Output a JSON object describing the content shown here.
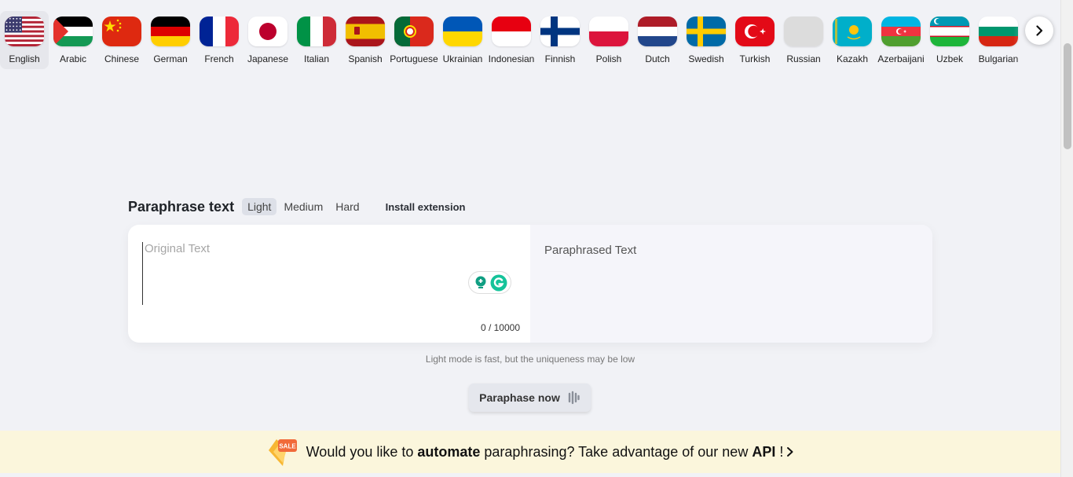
{
  "languages": [
    {
      "label": "English",
      "icon": "flag-us-icon",
      "selected": true
    },
    {
      "label": "Arabic",
      "icon": "flag-arabic-icon"
    },
    {
      "label": "Chinese",
      "icon": "flag-china-icon"
    },
    {
      "label": "German",
      "icon": "flag-germany-icon"
    },
    {
      "label": "French",
      "icon": "flag-france-icon"
    },
    {
      "label": "Japanese",
      "icon": "flag-japan-icon"
    },
    {
      "label": "Italian",
      "icon": "flag-italy-icon"
    },
    {
      "label": "Spanish",
      "icon": "flag-spain-icon"
    },
    {
      "label": "Portuguese",
      "icon": "flag-portugal-icon"
    },
    {
      "label": "Ukrainian",
      "icon": "flag-ukraine-icon"
    },
    {
      "label": "Indonesian",
      "icon": "flag-indonesia-icon"
    },
    {
      "label": "Finnish",
      "icon": "flag-finland-icon"
    },
    {
      "label": "Polish",
      "icon": "flag-poland-icon"
    },
    {
      "label": "Dutch",
      "icon": "flag-netherlands-icon"
    },
    {
      "label": "Swedish",
      "icon": "flag-sweden-icon"
    },
    {
      "label": "Turkish",
      "icon": "flag-turkey-icon"
    },
    {
      "label": "Russian",
      "icon": "flag-russia-icon"
    },
    {
      "label": "Kazakh",
      "icon": "flag-kazakhstan-icon"
    },
    {
      "label": "Azerbaijani",
      "icon": "flag-azerbaijan-icon"
    },
    {
      "label": "Uzbek",
      "icon": "flag-uzbekistan-icon"
    },
    {
      "label": "Bulgarian",
      "icon": "flag-bulgaria-icon"
    }
  ],
  "toolbar": {
    "title": "Paraphrase text",
    "modes": [
      "Light",
      "Medium",
      "Hard"
    ],
    "active_mode": "Light",
    "install_label": "Install extension"
  },
  "editor": {
    "original_placeholder": "Original Text",
    "original_value": "",
    "char_count": "0 / 10000",
    "paraphrased_label": "Paraphrased Text"
  },
  "mode_hint": "Light mode is fast, but the uniqueness may be low",
  "submit": {
    "label": "Paraphase now"
  },
  "banner": {
    "sale_badge": "SALE",
    "text_1": "Would you like to ",
    "text_bold_1": "automate",
    "text_2": " paraphrasing? Take advantage of our new ",
    "text_bold_2": "API",
    "text_3": " !"
  },
  "colors": {
    "page_bg": "#f1f2f6",
    "banner_bg": "#fbf6dc",
    "active_mode_bg": "#dde0e8",
    "grammarly_green": "#15c39a"
  }
}
